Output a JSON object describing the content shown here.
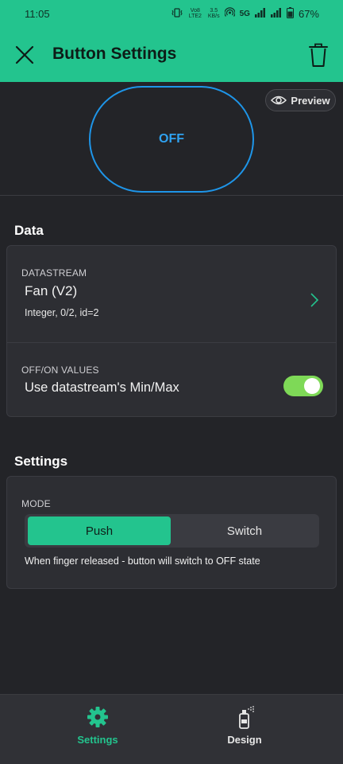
{
  "status_bar": {
    "time": "11:05",
    "volte": "Vo8 LTE2",
    "speed_value": "3.5",
    "speed_unit": "KB/s",
    "network": "5G",
    "battery": "67%"
  },
  "app_bar": {
    "title": "Button Settings",
    "close_icon": "close-icon",
    "trash_icon": "trash-icon"
  },
  "preview": {
    "chip_label": "Preview",
    "button_state_label": "OFF"
  },
  "data_section": {
    "title": "Data",
    "datastream": {
      "label": "DATASTREAM",
      "name": "Fan (V2)",
      "meta": "Integer, 0/2, id=2"
    },
    "values": {
      "label": "OFF/ON VALUES",
      "text": "Use datastream's Min/Max",
      "enabled": true
    }
  },
  "settings_section": {
    "title": "Settings",
    "mode": {
      "label": "MODE",
      "options": [
        "Push",
        "Switch"
      ],
      "selected": "Push",
      "help": "When finger released - button will switch to OFF state"
    }
  },
  "bottom_nav": {
    "items": [
      {
        "label": "Settings",
        "icon": "gear-icon",
        "active": true
      },
      {
        "label": "Design",
        "icon": "spray-paint-icon",
        "active": false
      }
    ]
  },
  "colors": {
    "accent": "#23c48e",
    "button_outline": "#1e95e8",
    "toggle_on": "#7ed957",
    "background": "#232428",
    "card": "#2d2e33"
  }
}
